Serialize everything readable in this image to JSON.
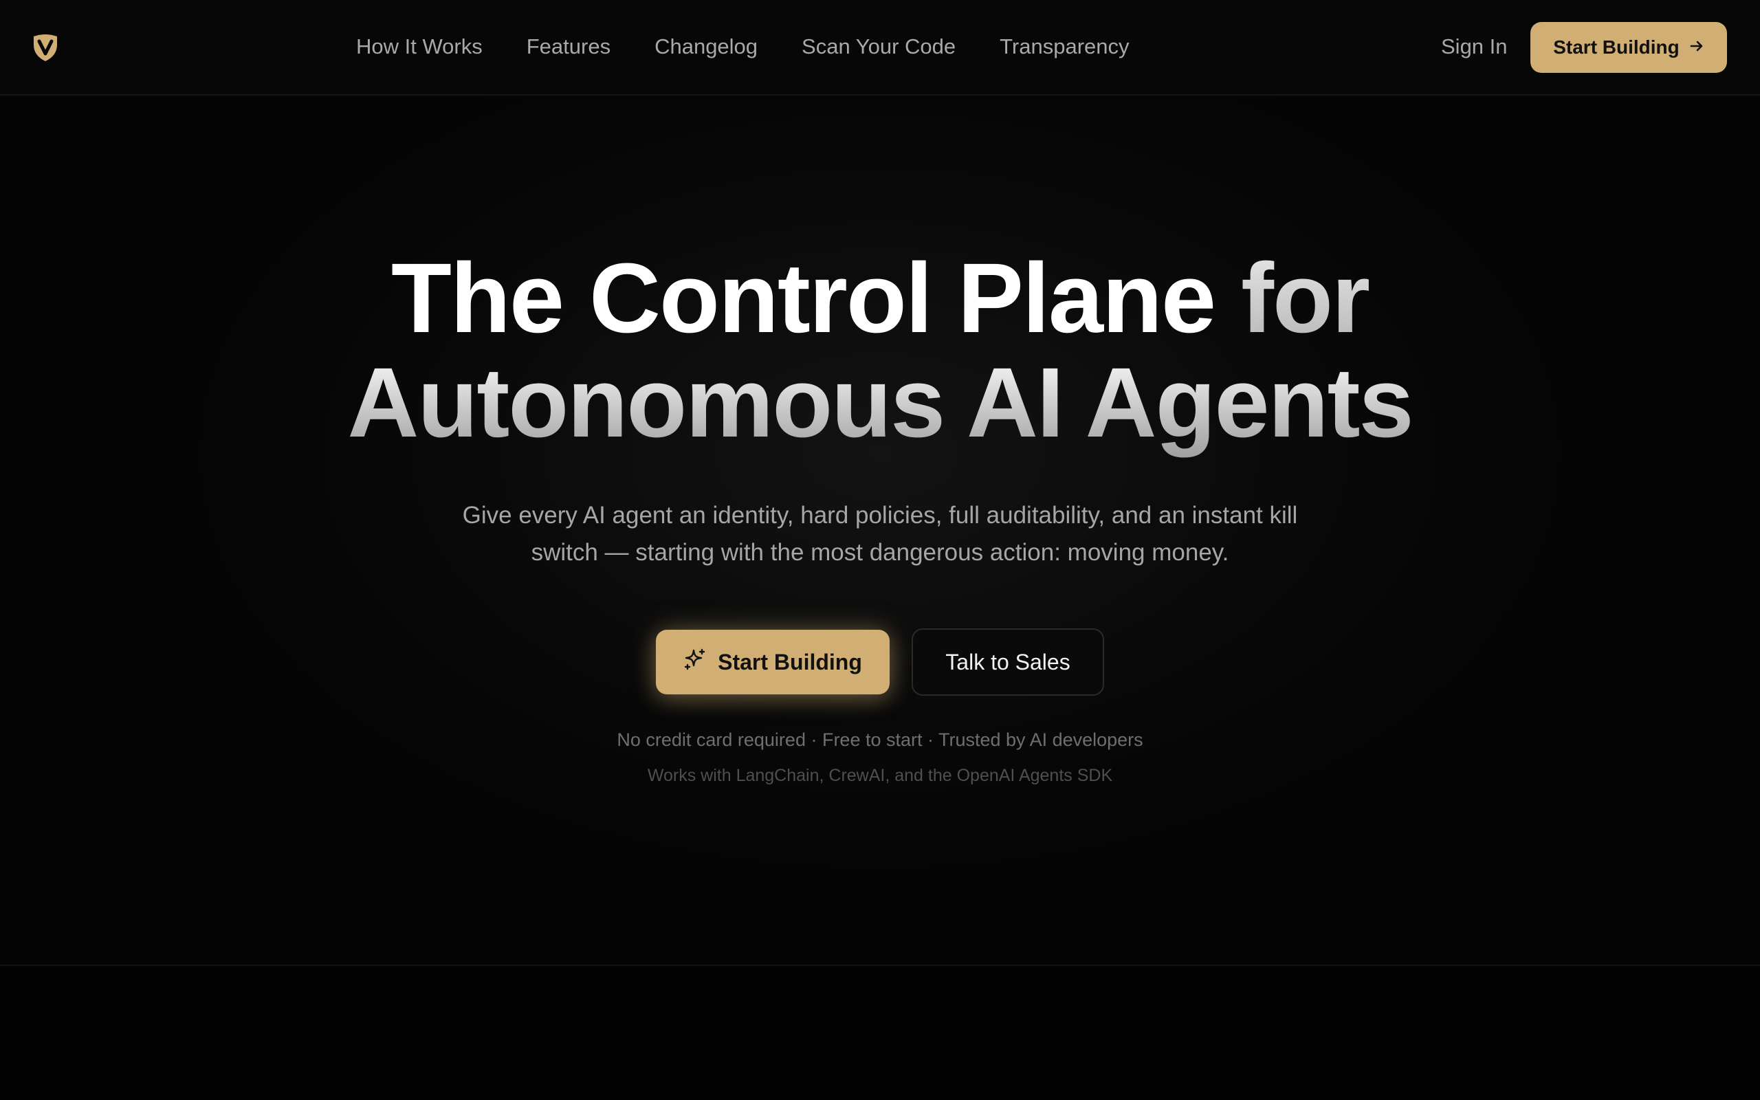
{
  "header": {
    "nav": [
      {
        "label": "How It Works"
      },
      {
        "label": "Features"
      },
      {
        "label": "Changelog"
      },
      {
        "label": "Scan Your Code"
      },
      {
        "label": "Transparency"
      }
    ],
    "sign_in_label": "Sign In",
    "cta_label": "Start Building"
  },
  "hero": {
    "headline_line1_main": "The Control Plane",
    "headline_line1_end": "for",
    "headline_line2": "Autonomous AI Agents",
    "subtitle_line1": "Give every AI agent an identity, hard policies, full auditability, and an instant kill",
    "subtitle_line2": "switch — starting with the most dangerous action: moving money.",
    "primary_cta_label": "Start Building",
    "secondary_cta_label": "Talk to Sales",
    "note_primary": "No credit card required · Free to start · Trusted by AI developers",
    "note_secondary": "Works with LangChain, CrewAI, and the OpenAI Agents SDK"
  },
  "icons": {
    "logo": "shield-v-logo-icon",
    "header_cta": "arrow-right-icon",
    "primary_cta": "sparkles-icon"
  },
  "colors": {
    "background": "#040404",
    "accent": "#d1ae74",
    "text_muted": "#a9a9a9"
  }
}
